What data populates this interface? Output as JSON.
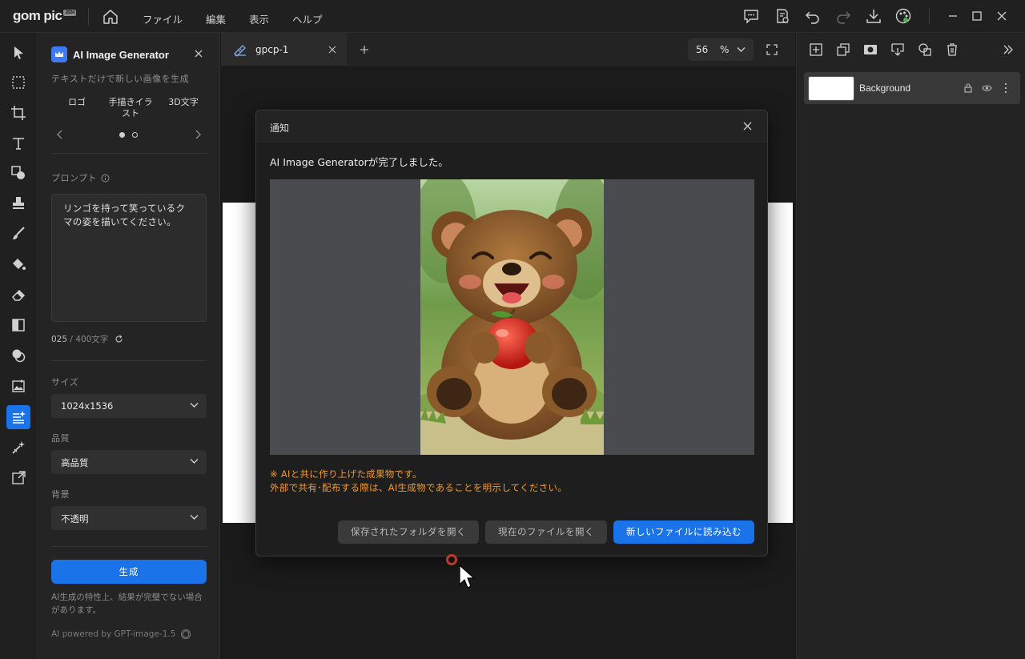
{
  "app": {
    "logo_main": "gom",
    "logo_sub": "pic",
    "logo_badge": "2024"
  },
  "menu": [
    "ファイル",
    "編集",
    "表示",
    "ヘルプ"
  ],
  "left_panel": {
    "title": "AI Image Generator",
    "subtitle": "テキストだけで新しい画像を生成",
    "style_tabs": [
      "ロゴ",
      "手描きイラスト",
      "3D文字"
    ],
    "style_tab_2_line1": "手描きイラ",
    "style_tab_2_line2": "スト",
    "prompt_label": "プロンプト",
    "prompt_text": "リンゴを持って笑っているクマの姿を描いてください。",
    "counter_current": "025",
    "counter_max": " / 400文字",
    "size_label": "サイズ",
    "size_value": "1024x1536",
    "quality_label": "品質",
    "quality_value": "高品質",
    "background_label": "背景",
    "background_value": "不透明",
    "generate_label": "生成",
    "note": "AI生成の特性上、結果が完璧でない場合があります。",
    "powered_by": "AI powered by GPT-image-1.5"
  },
  "canvas": {
    "tab_name": "gpcp-1",
    "zoom_value": "56",
    "zoom_unit": "%"
  },
  "dialog": {
    "title": "通知",
    "message": "AI Image Generatorが完了しました。",
    "warning_line1": "※ AIと共に作り上げた成果物です。",
    "warning_line2": "外部で共有･配布する際は、AI生成物であることを明示してください。",
    "btn_open_folder": "保存されたフォルダを開く",
    "btn_open_current": "現在のファイルを開く",
    "btn_load_new": "新しいファイルに読み込む"
  },
  "layers": [
    {
      "name": "Background"
    }
  ],
  "colors": {
    "accent": "#1a73e8",
    "warning": "#f39a2c"
  }
}
